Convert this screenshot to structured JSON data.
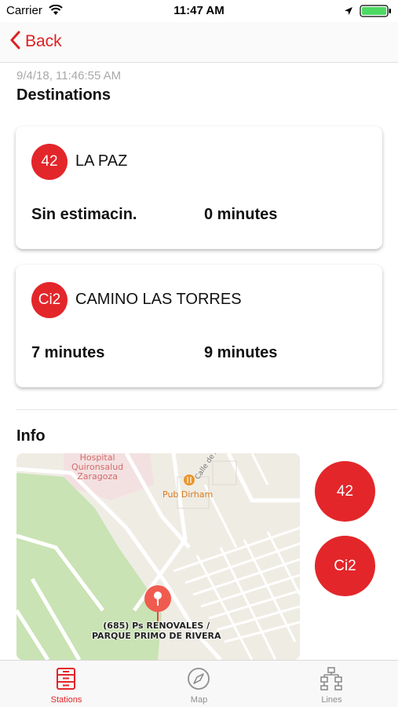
{
  "status_bar": {
    "carrier": "Carrier",
    "time": "11:47 AM"
  },
  "nav": {
    "back_label": "Back"
  },
  "timestamp": "9/4/18, 11:46:55 AM",
  "destinations_title": "Destinations",
  "destinations": [
    {
      "line": "42",
      "name": "LA PAZ",
      "estimate_1": "Sin estimacin.",
      "estimate_2": "0 minutes"
    },
    {
      "line": "Ci2",
      "name": "CAMINO LAS TORRES",
      "estimate_1": "7 minutes",
      "estimate_2": "9 minutes"
    }
  ],
  "info_title": "Info",
  "map": {
    "hospital_line1": "Hospital",
    "hospital_line2": "Quironsalud",
    "hospital_line3": "Zaragoza",
    "pub": "Pub Dirham",
    "street": "Calle de Arzobispo Casi",
    "stop_line1": "(685) Ps RENOVALES /",
    "stop_line2": "PARQUE PRIMO DE RIVERA"
  },
  "lines": [
    "42",
    "Ci2"
  ],
  "tabs": {
    "stations": "Stations",
    "map": "Map",
    "lines": "Lines"
  },
  "colors": {
    "accent": "#e3262a",
    "park": "#c9e3b4",
    "map_bg": "#efece4"
  },
  "icons": [
    "wifi-icon",
    "location-arrow-icon",
    "battery-icon",
    "back-chevron-icon",
    "restaurant-icon",
    "map-pin-icon",
    "stations-icon",
    "compass-icon",
    "network-icon"
  ]
}
